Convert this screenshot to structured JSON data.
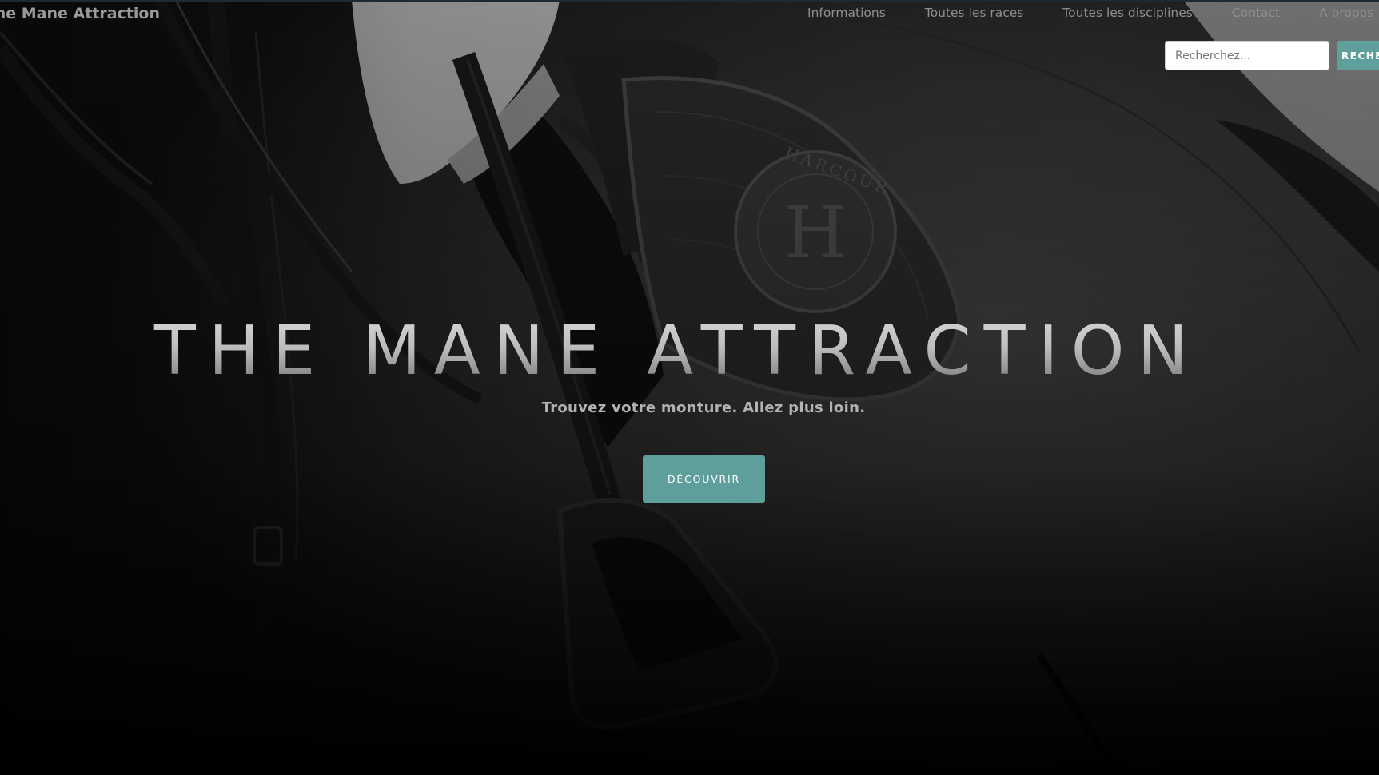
{
  "header": {
    "brand": "The Mane Attraction",
    "nav": [
      {
        "label": "Informations"
      },
      {
        "label": "Toutes les races"
      },
      {
        "label": "Toutes les disciplines"
      },
      {
        "label": "Contact"
      },
      {
        "label": "A propos"
      }
    ],
    "search": {
      "placeholder": "Recherchez...",
      "value": "",
      "button_label": "RECHERCHER"
    }
  },
  "hero": {
    "title": "THE MANE ATTRACTION",
    "subtitle": "Trouvez votre monture. Allez plus loin.",
    "cta_label": "DÉCOUVRIR",
    "patch_text": "HARCOUR"
  },
  "colors": {
    "accent": "#5f9f9b",
    "background": "#1e1e1e",
    "nav_text": "#8f8f8f"
  }
}
